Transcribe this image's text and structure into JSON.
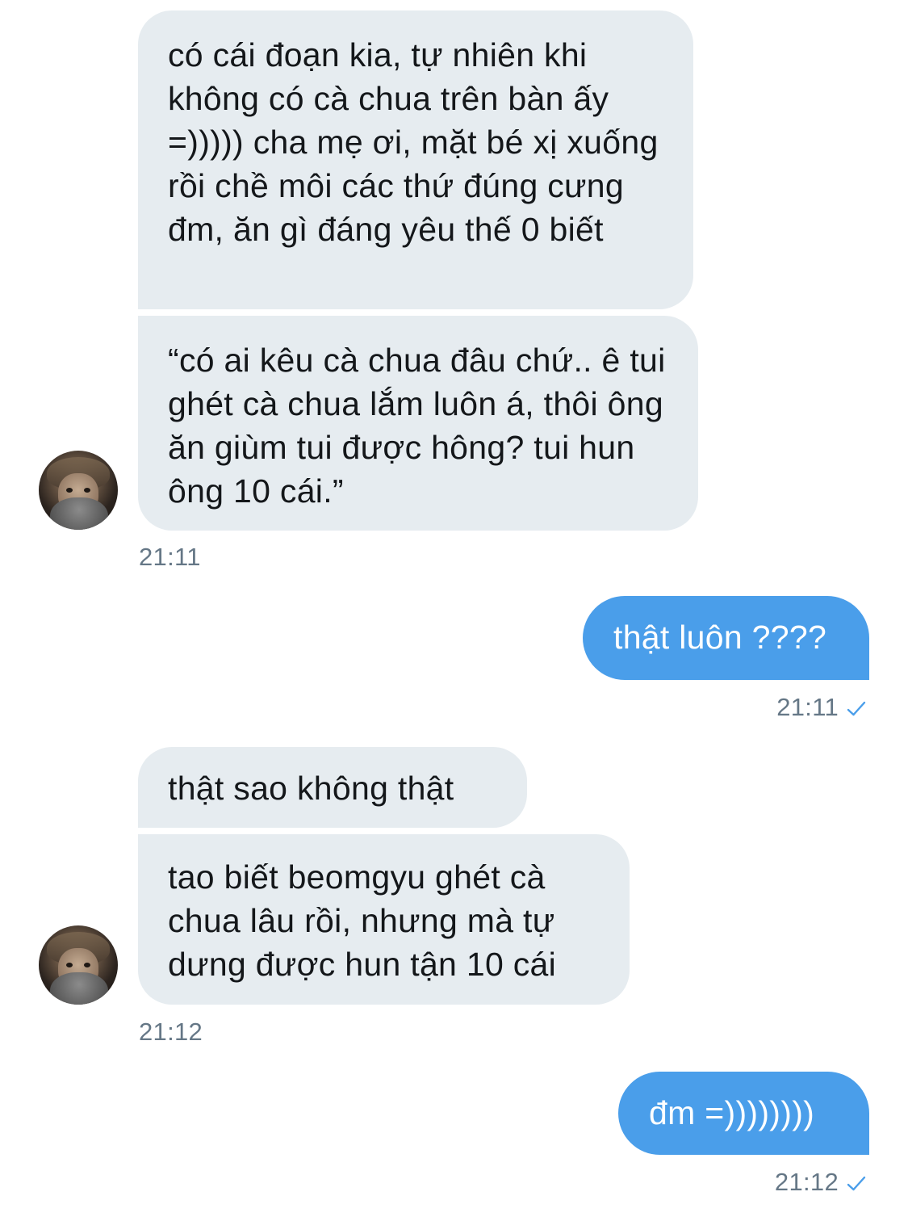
{
  "conversation": {
    "messages": [
      {
        "text": "có cái đoạn kia, tự nhiên khi không có cà chua trên bàn ấy =))))) cha mẹ ơi, mặt bé xị xuống rồi chề môi các thứ đúng cưng đm, ăn gì đáng yêu thế 0 biết"
      },
      {
        "text": "“có ai kêu cà chua đâu chứ.. ê tui ghét cà chua lắm luôn á, thôi ông ăn giùm tui được hông? tui hun ông 10 cái.”"
      },
      {
        "time": "21:11"
      },
      {
        "text": "thật luôn ????"
      },
      {
        "time": "21:11"
      },
      {
        "text": "thật sao không thật"
      },
      {
        "text": "tao biết beomgyu ghét cà chua lâu rồi, nhưng mà tự dưng được hun tận 10 cái"
      },
      {
        "time": "21:12"
      },
      {
        "text": "đm =))))))))"
      },
      {
        "time": "21:12"
      }
    ]
  },
  "colors": {
    "incoming_bubble": "#e6ecf0",
    "outgoing_bubble": "#4a9eea",
    "timestamp": "#657786",
    "read_check": "#4a9eea"
  },
  "icons": {
    "read_receipt": "checkmark-icon",
    "contact_avatar": "avatar"
  }
}
